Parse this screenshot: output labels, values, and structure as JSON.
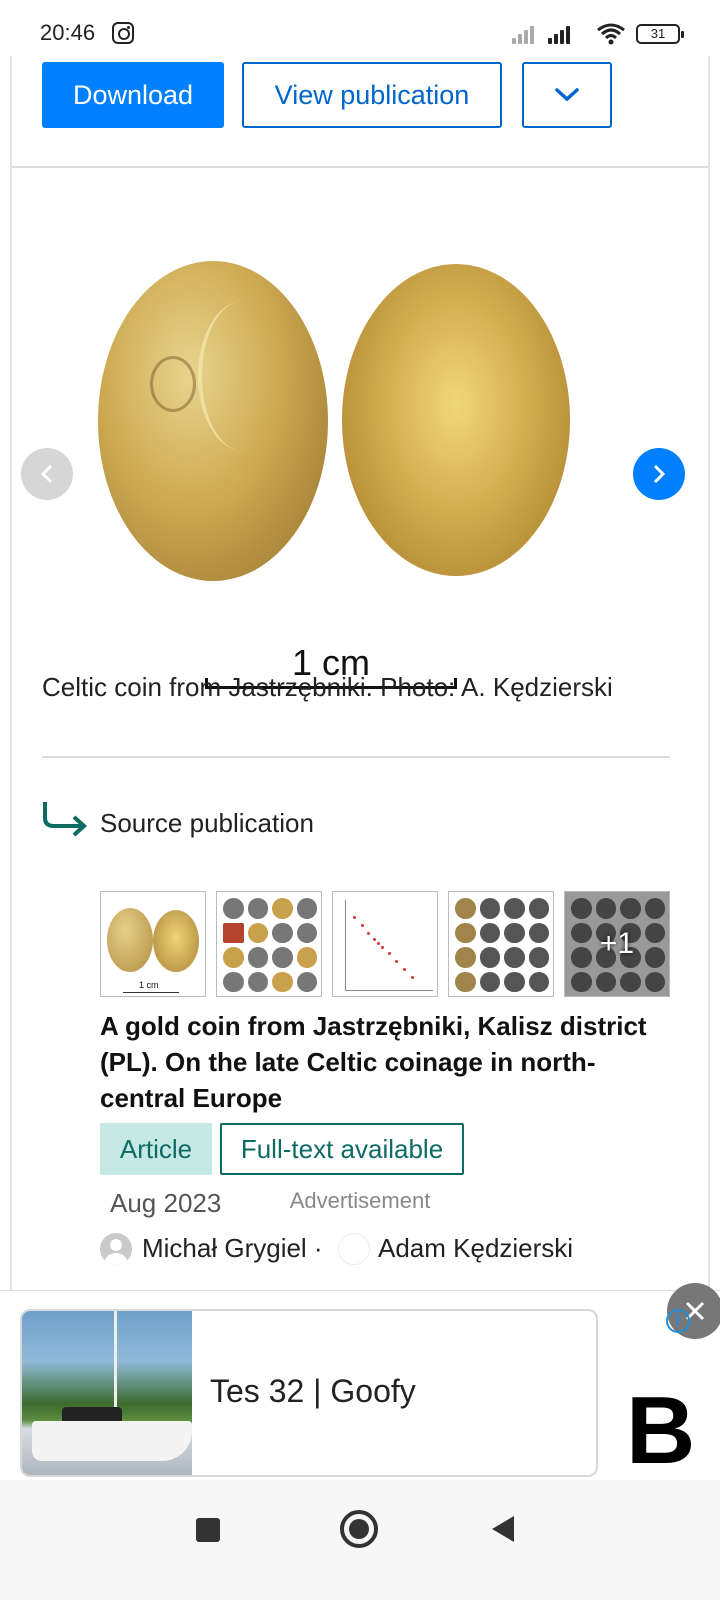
{
  "status_bar": {
    "time": "20:46",
    "battery": "31"
  },
  "actions": {
    "download_label": "Download",
    "view_publication_label": "View publication",
    "more_icon": "chevron-down-icon"
  },
  "figure": {
    "scale_label": "1 cm",
    "caption": "Celtic coin from Jastrzębniki. Photo: A. Kędzierski",
    "prev_icon": "chevron-left-icon",
    "next_icon": "chevron-right-icon"
  },
  "source": {
    "heading": "Source publication",
    "thumb1_scale": "1 cm",
    "more_count": "+1",
    "title": "A gold coin from Jastrzębniki, Kalisz district (PL). On the late Celtic coinage in north-central Europe",
    "badge_article": "Article",
    "badge_fulltext": "Full-text available",
    "date": "Aug 2023",
    "author1": "Michał Grygiel ·",
    "author2": "Adam Kędzierski"
  },
  "ad": {
    "label": "Advertisement",
    "text": "Tes 32 | Goofy",
    "logo": "B",
    "colors": {
      "accent": "#0080ff",
      "teal": "#0c6b63"
    }
  }
}
